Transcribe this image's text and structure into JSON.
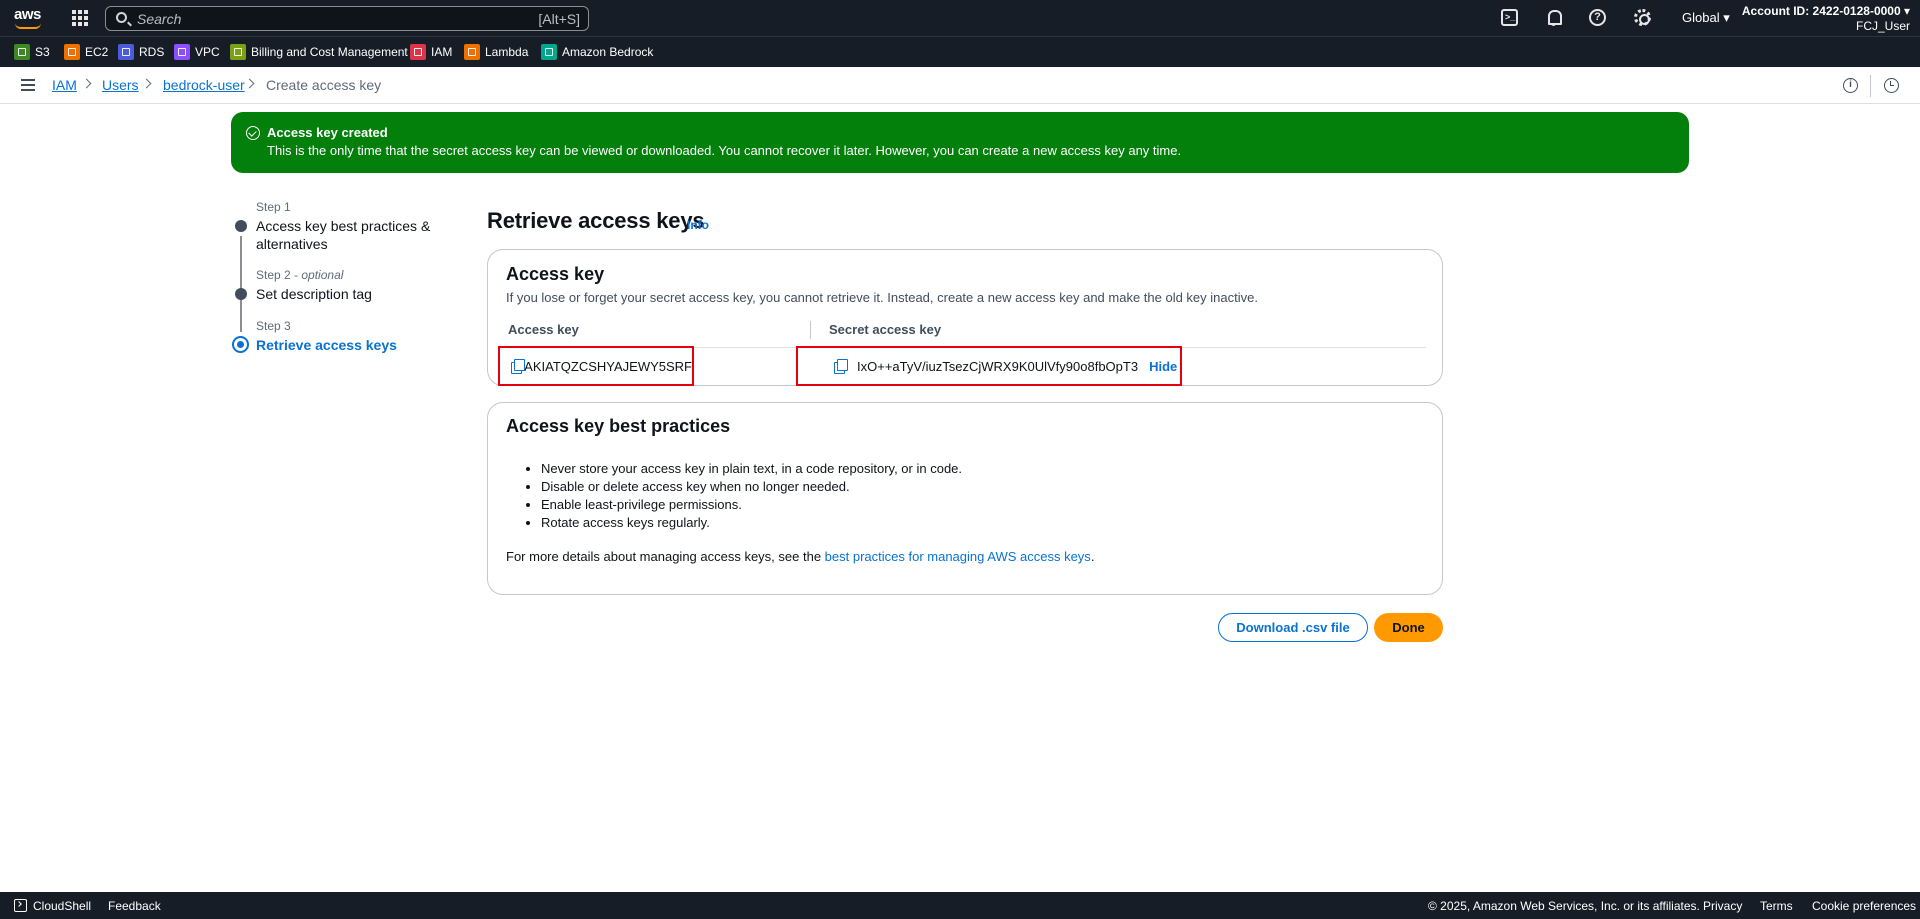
{
  "topnav": {
    "logo_text": "aws",
    "search_placeholder": "Search",
    "search_shortcut": "[Alt+S]",
    "region": "Global ▾",
    "account_id": "Account ID: 2422-0128-0000 ▾",
    "user": "FCJ_User",
    "help_glyph": "?"
  },
  "favorites": [
    {
      "label": "S3",
      "color": "#3f8624"
    },
    {
      "label": "EC2",
      "color": "#ed7100"
    },
    {
      "label": "RDS",
      "color": "#4d5bd9"
    },
    {
      "label": "VPC",
      "color": "#8c4fff"
    },
    {
      "label": "Billing and Cost Management",
      "color": "#7aa116"
    },
    {
      "label": "IAM",
      "color": "#dd344c"
    },
    {
      "label": "Lambda",
      "color": "#ed7100"
    },
    {
      "label": "Amazon Bedrock",
      "color": "#01a88d"
    }
  ],
  "breadcrumb": {
    "items": [
      "IAM",
      "Users",
      "bedrock-user"
    ],
    "current": "Create access key"
  },
  "flash": {
    "title": "Access key created",
    "message": "This is the only time that the secret access key can be viewed or downloaded. You cannot recover it later. However, you can create a new access key any time."
  },
  "steps": [
    {
      "label": "Step 1",
      "optional": "",
      "title": "Access key best practices & alternatives"
    },
    {
      "label": "Step 2",
      "optional": "optional",
      "title": "Set description tag"
    },
    {
      "label": "Step 3",
      "optional": "",
      "title": "Retrieve access keys"
    }
  ],
  "main": {
    "title": "Retrieve access keys",
    "info": "Info"
  },
  "access_key_card": {
    "heading": "Access key",
    "description": "If you lose or forget your secret access key, you cannot retrieve it. Instead, create a new access key and make the old key inactive.",
    "col_access_key": "Access key",
    "col_secret_key": "Secret access key",
    "access_key_value": "AKIATQZCSHYAJEWY5SRF",
    "secret_key_value": "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",
    "hide_label": "Hide"
  },
  "best_practices_card": {
    "heading": "Access key best practices",
    "items": [
      "Never store your access key in plain text, in a code repository, or in code.",
      "Disable or delete access key when no longer needed.",
      "Enable least-privilege permissions.",
      "Rotate access keys regularly."
    ],
    "more_prefix": "For more details about managing access keys, see the ",
    "more_link": "best practices for managing AWS access keys",
    "more_suffix": "."
  },
  "actions": {
    "download": "Download .csv file",
    "done": "Done"
  },
  "footer": {
    "cloudshell": "CloudShell",
    "feedback": "Feedback",
    "copyright": "© 2025, Amazon Web Services, Inc. or its affiliates.",
    "privacy": "Privacy",
    "terms": "Terms",
    "cookies": "Cookie preferences"
  },
  "colors": {
    "nav_bg": "#161d26",
    "success": "#037f0c",
    "link": "#0972d3",
    "primary_button": "#ff9900",
    "highlight_border": "#e5000f"
  }
}
